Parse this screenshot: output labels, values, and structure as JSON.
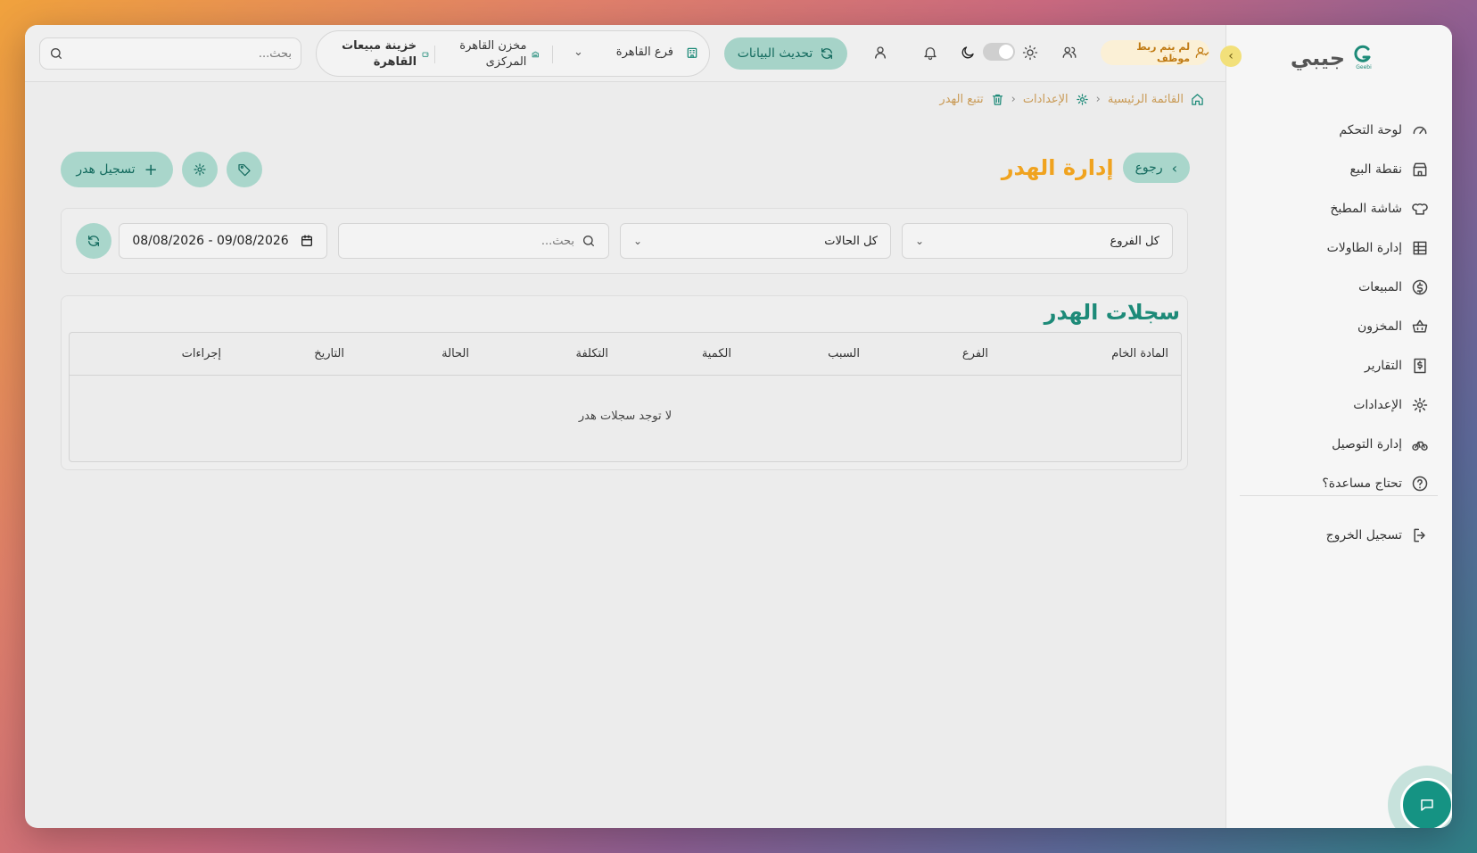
{
  "brand": {
    "name": "جيبي",
    "logo_text": "Geebi"
  },
  "sidebar": {
    "items": [
      {
        "label": "لوحة التحكم",
        "icon": "gauge-icon"
      },
      {
        "label": "نقطة البيع",
        "icon": "store-icon"
      },
      {
        "label": "شاشة المطبخ",
        "icon": "chef-hat-icon"
      },
      {
        "label": "إدارة الطاولات",
        "icon": "table-icon"
      },
      {
        "label": "المبيعات",
        "icon": "dollar-circle-icon"
      },
      {
        "label": "المخزون",
        "icon": "basket-icon"
      },
      {
        "label": "التقارير",
        "icon": "receipt-icon"
      },
      {
        "label": "الإعدادات",
        "icon": "gear-icon"
      },
      {
        "label": "إدارة التوصيل",
        "icon": "bike-icon"
      },
      {
        "label": "تحتاج مساعدة؟",
        "icon": "help-icon"
      }
    ],
    "logout": "تسجيل الخروج"
  },
  "topbar": {
    "search_placeholder": "بحث...",
    "treasury": "خزينة مبيعات القاهرة",
    "warehouse": "مخزن القاهرة المركزى",
    "branch": "فرع القاهرة",
    "refresh_label": "تحديث البيانات",
    "employee_badge": "لم يتم ربط موظف"
  },
  "breadcrumb": {
    "home": "القائمة الرئيسية",
    "settings": "الإعدادات",
    "current": "تتبع الهدر"
  },
  "page": {
    "title": "إدارة الهدر",
    "back_label": "رجوع",
    "record_label": "تسجيل هدر"
  },
  "filters": {
    "branch": "كل الفروع",
    "status": "كل الحالات",
    "search_placeholder": "بحث...",
    "date_range": "08/08/2026 - 09/08/2026"
  },
  "records": {
    "title": "سجلات الهدر",
    "columns": [
      "المادة الخام",
      "الفرع",
      "السبب",
      "الكمية",
      "التكلفة",
      "الحالة",
      "التاريخ",
      "إجراءات"
    ],
    "empty": "لا توجد سجلات هدر"
  },
  "colors": {
    "primary": "#1d8a78",
    "accent": "#f0a31f",
    "button_bg": "#a9d6cb"
  }
}
